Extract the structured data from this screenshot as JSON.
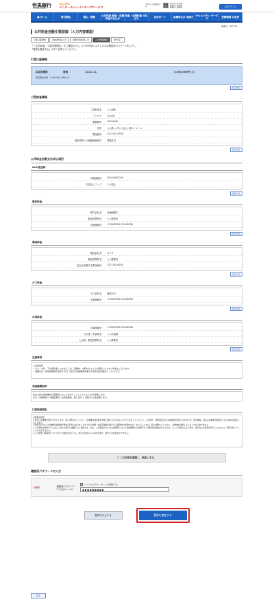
{
  "header": {
    "bank_name": "但馬銀行",
    "bank_sub": "TAJIMA BANK",
    "brand_line1": "たじぎん",
    "brand_line2": "インターネットバンキングサービス",
    "font_size_label": "文字サイズを変更する",
    "font_sizes": [
      "小",
      "あ",
      "あ"
    ],
    "logout": "ログアウト"
  },
  "nav": [
    {
      "label": "ホーム",
      "icon": "●"
    },
    {
      "label": "取引照会"
    },
    {
      "label": "振込・振替"
    },
    {
      "label": "公共料金 税金・各種料金の払込み"
    },
    {
      "label": "税金・各種料金 の払込み"
    },
    {
      "label": "住宅ローン"
    },
    {
      "label": "各種申込み 手続き"
    },
    {
      "label": "セキュリティ サービス"
    },
    {
      "label": "登録情報 の変更"
    }
  ],
  "screen_id": "画面ID：BKT004",
  "page_title": "公共料金自動引落登録（入力内容確認）",
  "steps": [
    "引落口座選択",
    "契約者情報入力",
    "自動引落情報入力",
    "入力内容確認",
    "受付完了"
  ],
  "intro": [
    "「ご注意事項」「口座振替規定」をご確認のうえ、以下の内容でよろしければ確認用パスワードを入力し、",
    "「登録を確定する」ボタンを押してください。"
  ],
  "account": {
    "section": "引落口座情報",
    "branch": "本店営業部",
    "type": "普通",
    "number": "1111111",
    "balance": "5,000,000円",
    "balance_note": "残高",
    "date_note": "残高照会日時　07月23日 10時00分"
  },
  "contractor": {
    "section": "ご契約者情報",
    "rows": [
      [
        "ご契約者名",
        "○○太郎"
      ],
      [
        "フリガナ",
        "ﾏﾙﾏﾙﾀﾛｳ"
      ],
      [
        "郵便番号",
        "000-0000"
      ],
      [
        "住所",
        "○○県○○市○○区○○町×－×－×"
      ],
      [
        "電話番号",
        "012-345-6789"
      ],
      [
        "領収書等への連絡届等送付",
        "希望する"
      ]
    ]
  },
  "fix_label": "訂正する",
  "payments_section": "公共料金自動支払申込項目",
  "nhk": {
    "title": "NHK受信料",
    "rows": [
      [
        "お客様番号",
        "000-0000-000"
      ],
      [
        "お支払いコース",
        "2ヶ月払"
      ]
    ]
  },
  "electric": {
    "title": "電気料金",
    "rows": [
      [
        "電力会社名",
        "北海道電力"
      ],
      [
        "取扱営業所名",
        "○○営業所"
      ],
      [
        "お客様番号",
        "123567890123456789"
      ]
    ]
  },
  "phone": {
    "title": "電話料金",
    "rows": [
      [
        "電話会社名",
        "ＮＴＴ"
      ],
      [
        "取扱営業所名",
        "○○営業所"
      ],
      [
        "支払を依頼する電話番号",
        "012-345-6789"
      ]
    ]
  },
  "gas": {
    "title": "ガス料金",
    "rows": [
      [
        "ガス会社名",
        "東京ガス"
      ],
      [
        "お客様番号",
        "123567890123456789"
      ]
    ]
  },
  "water": {
    "title": "水道料金",
    "rows": [
      [
        "お客様番号",
        "123567890123456789"
      ],
      [
        "上水道・水道局名",
        "○○水道局"
      ],
      [
        "上水道・取扱営業所名",
        "○○事業所"
      ]
    ]
  },
  "notes": {
    "title": "注意事項",
    "lines": [
      "ご注意事項",
      "・ガス、水道・下水道料金につきましては、事業体、市町村によってお取扱いできない場合もございます。",
      "・前届日は、各収納機関の指定する日（当日が金融機関休業日の場合は翌営業日）となります。"
    ]
  },
  "collector": {
    "title": "収納機関宛申",
    "lines": [
      "私は上記の請求書を口座振替によって支払うことといたしたいので依頼します。",
      "なお、収納機関への届出書または変更届は、私に変わって貴行から提出願います。"
    ]
  },
  "rules": {
    "title": "口座振替規定",
    "lines": [
      "口座振替規定",
      "1.貴行に請求書が送付されたときは、私に通知することなく、請求書記載金額を預金口座から引き落としのうえ支払ってください。この場合、預金規定または当座勘定規定にかかわらず、預金通帳、同払戻請求書の提出または小切手の振出しはしません。",
      "2.振替日において請求書記載金額が預金口座から払戻すことのできる金額（当座貸越を利用できる範囲内の金額を含む）をこえるときは、私に通知することなく、請求書を返却してもさしつかえありません。",
      "3.この契約を解約するときは、私から貴行に書面により届出ます。なお、この届出がないまま長期間にわたり収納機関から請求がない等相当の事由があるときは、とくに申出をしない限り、貴行はこの契約が終了したものとして取り扱ってさしつかえありません。",
      "4.この預金口座振替についてかりに紛議が生じても、貴行の責めによる場合を除き、貴行には迷惑をかけません。"
    ]
  },
  "agree_text": "□ この内容を確認し、承諾します。",
  "password": {
    "section": "確認用パスワードの入力",
    "required": "[必須]",
    "label": "確認用パスワード",
    "hint": "（半角英数字6～12桁）",
    "soft_kb": "ソフトウェアキーボードを使用する。",
    "value": "●●●●●●●●●"
  },
  "buttons": {
    "cancel": "登録を中止する",
    "confirm": "登録を確定する",
    "back": "戻る"
  }
}
